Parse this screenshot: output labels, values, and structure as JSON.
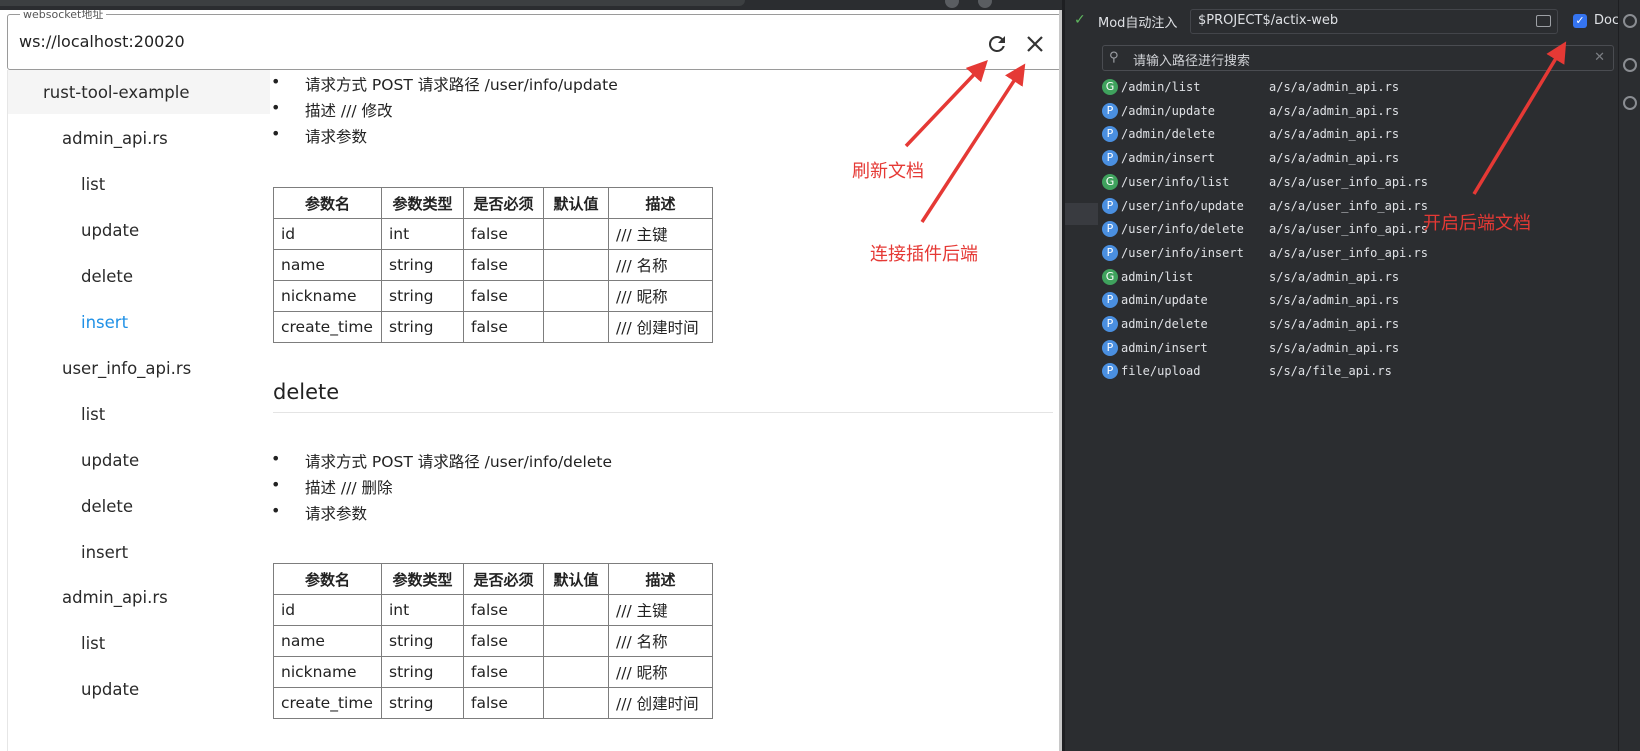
{
  "websocket": {
    "legend": "websocket地址",
    "url": "ws://localhost:20020"
  },
  "sidebar": {
    "root": "rust-tool-example",
    "groups": [
      {
        "label": "admin_api.rs",
        "items": [
          "list",
          "update",
          "delete",
          "insert"
        ]
      },
      {
        "label": "user_info_api.rs",
        "items": [
          "list",
          "update",
          "delete",
          "insert"
        ]
      },
      {
        "label": "admin_api.rs",
        "items": [
          "list",
          "update"
        ]
      }
    ],
    "active_item": "insert"
  },
  "content": {
    "update_section": {
      "bullets": [
        "请求方式 POST 请求路径 /user/info/update",
        "描述 /// 修改",
        "请求参数"
      ]
    },
    "delete_section": {
      "title": "delete",
      "bullets": [
        "请求方式 POST 请求路径 /user/info/delete",
        "描述 /// 删除",
        "请求参数"
      ]
    },
    "table": {
      "headers": [
        "参数名",
        "参数类型",
        "是否必须",
        "默认值",
        "描述"
      ],
      "rows": [
        [
          "id",
          "int",
          "false",
          "",
          "/// 主键"
        ],
        [
          "name",
          "string",
          "false",
          "",
          "/// 名称"
        ],
        [
          "nickname",
          "string",
          "false",
          "",
          "/// 昵称"
        ],
        [
          "create_time",
          "string",
          "false",
          "",
          "/// 创建时间"
        ]
      ]
    }
  },
  "annotations": {
    "refresh": "刷新文档",
    "connect": "连接插件后端",
    "enable_doc": "开启后端文档",
    "color": "#e53935"
  },
  "ide": {
    "mod_label": "Mod自动注入",
    "project_path": "$PROJECT$/actix-web",
    "doc_checkbox_label": "Doc",
    "doc_checked": true,
    "search_placeholder": "请输入路径进行搜索",
    "apis": [
      {
        "method": "G",
        "path": "/admin/list",
        "file": "a/s/a/admin_api.rs"
      },
      {
        "method": "P",
        "path": "/admin/update",
        "file": "a/s/a/admin_api.rs"
      },
      {
        "method": "P",
        "path": "/admin/delete",
        "file": "a/s/a/admin_api.rs"
      },
      {
        "method": "P",
        "path": "/admin/insert",
        "file": "a/s/a/admin_api.rs"
      },
      {
        "method": "G",
        "path": "/user/info/list",
        "file": "a/s/a/user_info_api.rs"
      },
      {
        "method": "P",
        "path": "/user/info/update",
        "file": "a/s/a/user_info_api.rs"
      },
      {
        "method": "P",
        "path": "/user/info/delete",
        "file": "a/s/a/user_info_api.rs"
      },
      {
        "method": "P",
        "path": "/user/info/insert",
        "file": "a/s/a/user_info_api.rs"
      },
      {
        "method": "G",
        "path": "admin/list",
        "file": "s/s/a/admin_api.rs"
      },
      {
        "method": "P",
        "path": "admin/update",
        "file": "s/s/a/admin_api.rs"
      },
      {
        "method": "P",
        "path": "admin/delete",
        "file": "s/s/a/admin_api.rs"
      },
      {
        "method": "P",
        "path": "admin/insert",
        "file": "s/s/a/admin_api.rs"
      },
      {
        "method": "P",
        "path": "file/upload",
        "file": "s/s/a/file_api.rs"
      }
    ],
    "method_colors": {
      "G": "#3fa25d",
      "P": "#4a8fe0"
    }
  }
}
